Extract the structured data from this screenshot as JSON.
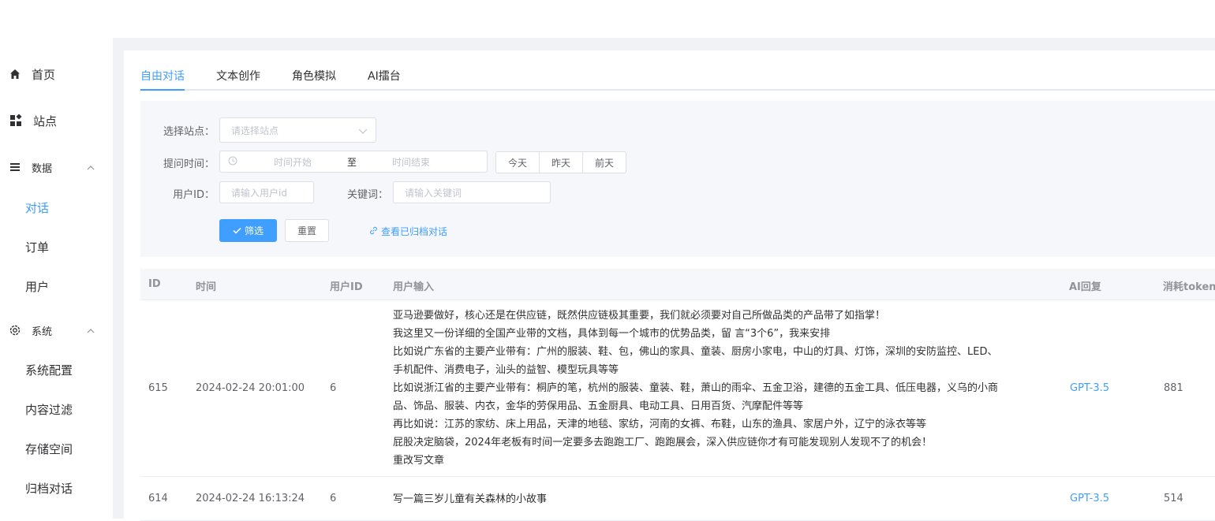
{
  "sidebar": {
    "home": "首页",
    "sites": "站点",
    "data_group": "数据",
    "data_items": [
      "对话",
      "订单",
      "用户"
    ],
    "system_group": "系统",
    "system_items": [
      "系统配置",
      "内容过滤",
      "存储空间",
      "归档对话"
    ]
  },
  "tabs": [
    "自由对话",
    "文本创作",
    "角色模拟",
    "AI擂台"
  ],
  "filters": {
    "site_label": "选择站点：",
    "site_placeholder": "请选择站点",
    "time_label": "提问时间：",
    "time_start": "时间开始",
    "time_sep": "至",
    "time_end": "时间结束",
    "quick": [
      "今天",
      "昨天",
      "前天"
    ],
    "user_label": "用户ID：",
    "user_placeholder": "请输入用户id",
    "keyword_label": "关键词：",
    "keyword_placeholder": "请输入关键词",
    "filter_btn": "筛选",
    "reset_btn": "重置",
    "archive_link": "查看已归档对话"
  },
  "table": {
    "headers": [
      "ID",
      "时间",
      "用户ID",
      "用户输入",
      "AI回复",
      "消耗token"
    ],
    "rows": [
      {
        "id": "615",
        "time": "2024-02-24 20:01:00",
        "user_id": "6",
        "input_lines": [
          "亚马逊要做好，核心还是在供应链，既然供应链极其重要，我们就必须要对自己所做品类的产品带了如指掌！",
          "我这里又一份详细的全国产业带的文档，具体到每一个城市的优势品类，留 言“3个6”，我来安排",
          "比如说广东省的主要产业带有：广州的服装、鞋、包，佛山的家具、童装、厨房小家电，中山的灯具、灯饰，深圳的安防监控、LED、",
          "手机配件、消费电子，汕头的益智、模型玩具等等",
          "比如说浙江省的主要产业带有：桐庐的笔，杭州的服装、童装、鞋，萧山的雨伞、五金卫浴，建德的五金工具、低压电器，义乌的小商",
          "品、饰品、服装、内衣，金华的劳保用品、五金厨具、电动工具、日用百货、汽摩配件等等",
          "再比如说：江苏的家纺、床上用品，天津的地毯、家纺，河南的女裤、布鞋，山东的渔具、家居户外，辽宁的泳衣等等",
          "屁股决定脑袋，2024年老板有时间一定要多去跑跑工厂、跑跑展会，深入供应链你才有可能发现别人发现不了的机会！",
          "重改写文章"
        ],
        "ai": "GPT-3.5",
        "tokens": "881"
      },
      {
        "id": "614",
        "time": "2024-02-24 16:13:24",
        "user_id": "6",
        "input_lines": [
          "写一篇三岁儿童有关森林的小故事"
        ],
        "ai": "GPT-3.5",
        "tokens": "514"
      }
    ]
  },
  "colors": {
    "primary": "#409eff",
    "bg": "#f0f2f5"
  }
}
